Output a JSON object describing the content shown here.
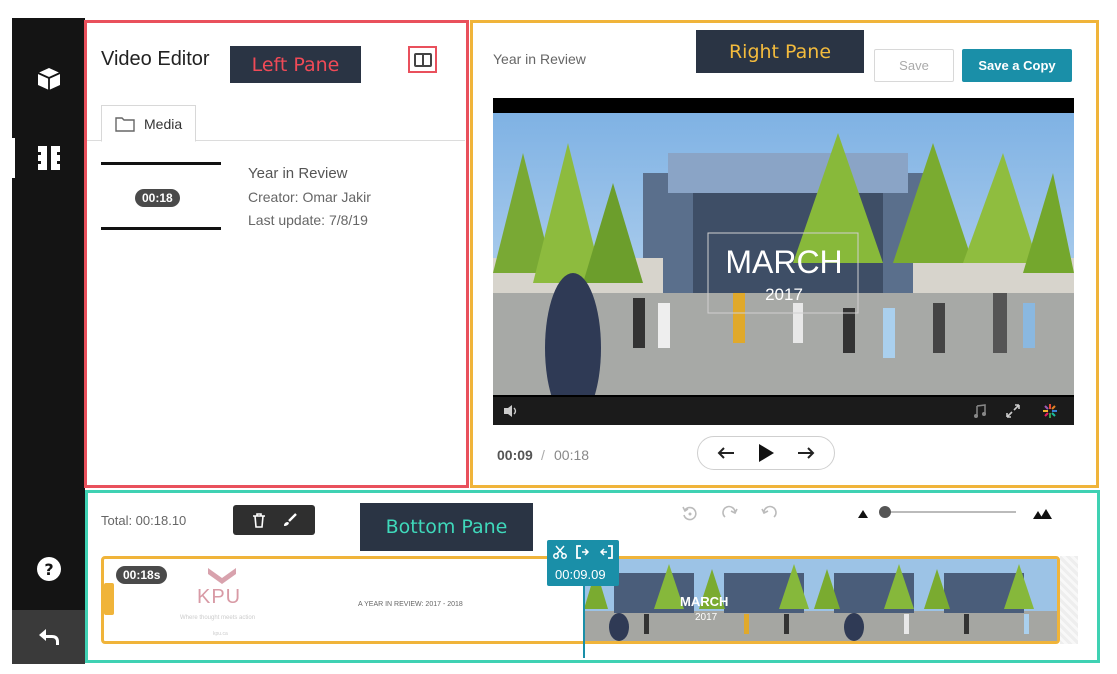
{
  "annotations": {
    "left": "Left Pane",
    "right": "Right Pane",
    "bottom": "Bottom Pane"
  },
  "sidebar": {
    "items": [
      {
        "icon": "cube-icon"
      },
      {
        "icon": "film-icon"
      },
      {
        "icon": "help-icon"
      },
      {
        "icon": "back-arrow-icon"
      }
    ]
  },
  "left_pane": {
    "title": "Video Editor",
    "tab": "Media",
    "entry": {
      "duration": "00:18",
      "title": "Year in Review",
      "creator": "Creator: Omar Jakir",
      "last_update": "Last update: 7/8/19"
    }
  },
  "right_pane": {
    "title": "Year in Review",
    "save_label": "Save",
    "save_copy_label": "Save a Copy",
    "video": {
      "overlay_title": "MARCH",
      "overlay_year": "2017"
    },
    "time_current": "00:09",
    "time_separator": "/",
    "time_total": "00:18"
  },
  "bottom_pane": {
    "total": "Total: 00:18.10",
    "clip_duration": "00:18s",
    "playhead_time": "00:09.09",
    "kpu": {
      "logo_text": "KPU",
      "tagline": "Where thought meets action",
      "small": "kpu.ca"
    },
    "title_card": "A YEAR IN REVIEW: 2017 - 2018",
    "film_title": "MARCH",
    "film_year": "2017"
  },
  "colors": {
    "accent": "#1a8fa8",
    "left_frame": "#e9505c",
    "right_frame": "#f0b43a",
    "bottom_frame": "#3fd1b3",
    "sidebar": "#141414"
  }
}
